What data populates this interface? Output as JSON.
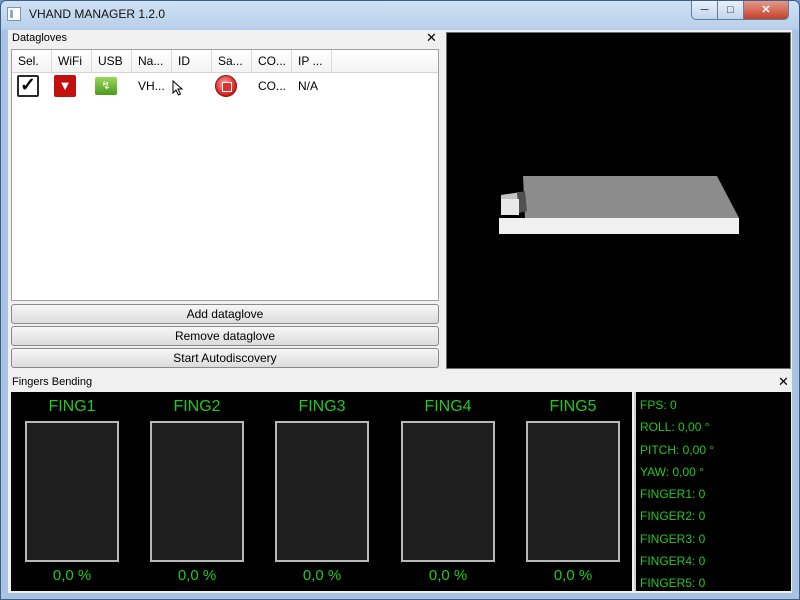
{
  "window": {
    "title": "VHAND MANAGER 1.2.0",
    "min_glyph": "─",
    "max_glyph": "□",
    "close_glyph": "✕"
  },
  "datagloves": {
    "title": "Datagloves",
    "close_glyph": "✕",
    "columns": [
      "Sel.",
      "WiFi",
      "USB",
      "Na...",
      "ID",
      "Sa...",
      "CO...",
      "IP ..."
    ],
    "rows": [
      {
        "sel_glyph": "✓",
        "wifi_glyph": "▼",
        "usb_glyph": "↯",
        "name": "VH...",
        "id": "",
        "com": "CO...",
        "ip": "N/A"
      }
    ],
    "buttons": {
      "add": "Add dataglove",
      "remove": "Remove dataglove",
      "autodiscovery": "Start Autodiscovery"
    }
  },
  "fingers": {
    "title": "Fingers Bending",
    "close_glyph": "✕",
    "items": [
      {
        "label": "FING1",
        "percent": "0,0 %",
        "value": 0
      },
      {
        "label": "FING2",
        "percent": "0,0 %",
        "value": 0
      },
      {
        "label": "FING3",
        "percent": "0,0 %",
        "value": 0
      },
      {
        "label": "FING4",
        "percent": "0,0 %",
        "value": 0
      },
      {
        "label": "FING5",
        "percent": "0,0 %",
        "value": 0
      }
    ],
    "stats": [
      "FPS: 0",
      "ROLL: 0,00 °",
      "PITCH: 0,00 °",
      "YAW: 0,00 °",
      "FINGER1: 0",
      "FINGER2: 0",
      "FINGER3: 0",
      "FINGER4: 0",
      "FINGER5: 0"
    ]
  },
  "colors": {
    "accent_green": "#22c822",
    "viewport_bg": "#000000",
    "wifi_icon": "#c21010",
    "save_icon": "#d01818"
  },
  "icons": {
    "selection": "checkbox-checked-icon",
    "wifi": "wifi-icon",
    "usb": "usb-icon",
    "save": "record-stop-icon",
    "cursor": "mouse-pointer-icon"
  }
}
